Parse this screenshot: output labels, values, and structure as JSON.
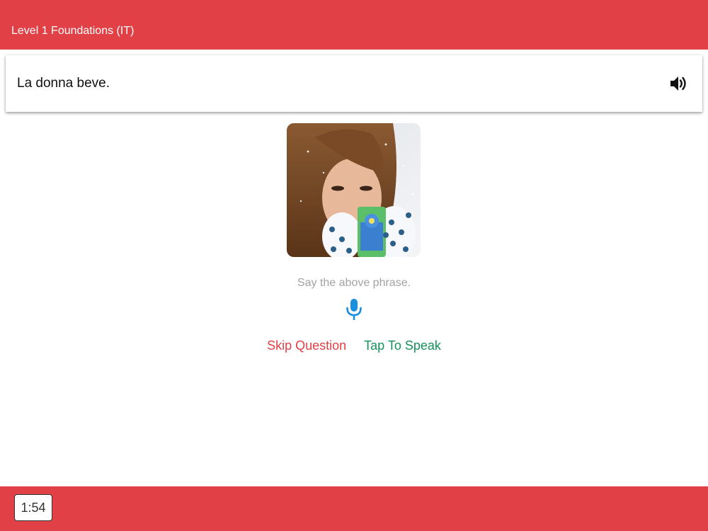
{
  "header": {
    "title": "Level 1 Foundations (IT)"
  },
  "phrase_card": {
    "phrase": "La donna beve.",
    "audio_icon": "speaker-icon"
  },
  "lesson": {
    "image_subject": "woman-drinking-from-cup",
    "instruction": "Say the above phrase.",
    "mic_icon": "microphone-icon",
    "skip_label": "Skip Question",
    "speak_label": "Tap To Speak"
  },
  "footer": {
    "timer": "1:54"
  },
  "colors": {
    "brand_red": "#e04046",
    "speak_green": "#16915a",
    "mic_blue": "#1a8fe0",
    "instruction_gray": "#a3a3a3"
  }
}
